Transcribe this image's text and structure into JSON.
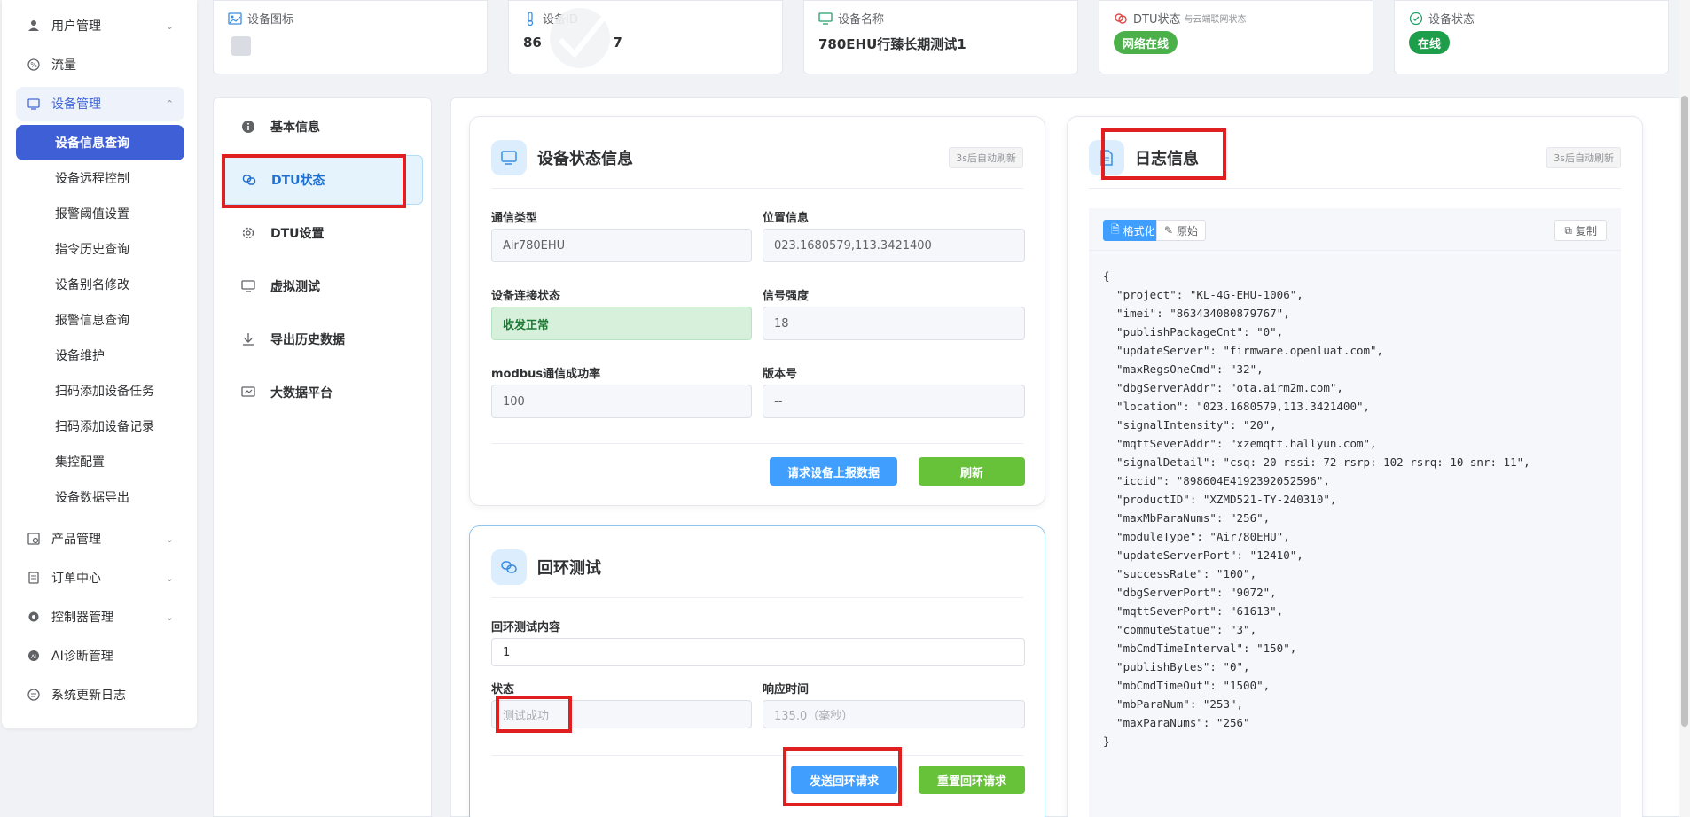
{
  "sidebar": {
    "menus": [
      {
        "label": "用户管理",
        "icon": "user-icon",
        "has_chevron": true
      },
      {
        "label": "流量",
        "icon": "traffic-icon",
        "has_chevron": false
      },
      {
        "label": "设备管理",
        "icon": "device-icon",
        "has_chevron": true,
        "open": true
      }
    ],
    "sub_items": [
      "设备信息查询",
      "设备远程控制",
      "报警阈值设置",
      "指令历史查询",
      "设备别名修改",
      "报警信息查询",
      "设备维护",
      "扫码添加设备任务",
      "扫码添加设备记录",
      "集控配置",
      "设备数据导出"
    ],
    "active_sub": "设备信息查询",
    "bottom_menus": [
      {
        "label": "产品管理",
        "icon": "product-icon",
        "has_chevron": true
      },
      {
        "label": "订单中心",
        "icon": "order-icon",
        "has_chevron": true
      },
      {
        "label": "控制器管理",
        "icon": "gear-icon",
        "has_chevron": true
      },
      {
        "label": "AI诊断管理",
        "icon": "ai-icon",
        "has_chevron": false
      },
      {
        "label": "系统更新日志",
        "icon": "log-icon",
        "has_chevron": false
      }
    ]
  },
  "top_cards": {
    "icon_card": {
      "label": "设备图标"
    },
    "id_card": {
      "label": "设备ID",
      "value_prefix": "86",
      "value_suffix": "7"
    },
    "name_card": {
      "label": "设备名称",
      "value": "780EHU行臻长期测试1"
    },
    "dtu_card": {
      "label": "DTU状态",
      "sub": "与云端联网状态",
      "pill": "网络在线",
      "pill_color": "#4cb04a"
    },
    "status_card": {
      "label": "设备状态",
      "pill": "在线",
      "pill_color": "#1e9e4a"
    }
  },
  "tabs": [
    {
      "label": "基本信息",
      "icon": "info-icon"
    },
    {
      "label": "DTU状态",
      "icon": "link-icon",
      "active": true
    },
    {
      "label": "DTU设置",
      "icon": "gear-icon"
    },
    {
      "label": "虚拟测试",
      "icon": "monitor-icon"
    },
    {
      "label": "导出历史数据",
      "icon": "download-icon"
    },
    {
      "label": "大数据平台",
      "icon": "dashboard-icon"
    }
  ],
  "status_card": {
    "title": "设备状态信息",
    "auto_refresh": "3s后自动刷新",
    "fields": {
      "comm_type": {
        "label": "通信类型",
        "value": "Air780EHU"
      },
      "location": {
        "label": "位置信息",
        "value": "023.1680579,113.3421400"
      },
      "conn_state": {
        "label": "设备连接状态",
        "value": "收发正常"
      },
      "signal": {
        "label": "信号强度",
        "value": "18"
      },
      "modbus_rate": {
        "label": "modbus通信成功率",
        "value": "100"
      },
      "version": {
        "label": "版本号",
        "value": "--"
      }
    },
    "btn_request": "请求设备上报数据",
    "btn_refresh": "刷新"
  },
  "loop_card": {
    "title": "回环测试",
    "content_label": "回环测试内容",
    "content_value": "1",
    "status_label": "状态",
    "status_value": "测试成功",
    "resp_label": "响应时间",
    "resp_value": "135.0（毫秒）",
    "btn_send": "发送回环请求",
    "btn_reset": "重置回环请求"
  },
  "log_card": {
    "title": "日志信息",
    "auto_refresh": "3s后自动刷新",
    "fmt_label": "格式化",
    "raw_label": "原始",
    "copy_label": "复制",
    "json_text": "{\n  \"project\": \"KL-4G-EHU-1006\",\n  \"imei\": \"863434080879767\",\n  \"publishPackageCnt\": \"0\",\n  \"updateServer\": \"firmware.openluat.com\",\n  \"maxRegsOneCmd\": \"32\",\n  \"dbgServerAddr\": \"ota.airm2m.com\",\n  \"location\": \"023.1680579,113.3421400\",\n  \"signalIntensity\": \"20\",\n  \"mqttSeverAddr\": \"xzemqtt.hallyun.com\",\n  \"signalDetail\": \"csq: 20 rssi:-72 rsrp:-102 rsrq:-10 snr: 11\",\n  \"iccid\": \"898604E4192392052596\",\n  \"productID\": \"XZMD521-TY-240310\",\n  \"maxMbParaNums\": \"256\",\n  \"moduleType\": \"Air780EHU\",\n  \"updateServerPort\": \"12410\",\n  \"successRate\": \"100\",\n  \"dbgServerPort\": \"9072\",\n  \"mqttSeverPort\": \"61613\",\n  \"commuteStatue\": \"3\",\n  \"mbCmdTimeInterval\": \"150\",\n  \"publishBytes\": \"0\",\n  \"mbCmdTimeOut\": \"1500\",\n  \"mbParaNum\": \"253\",\n  \"maxParaNums\": \"256\"\n}"
  }
}
